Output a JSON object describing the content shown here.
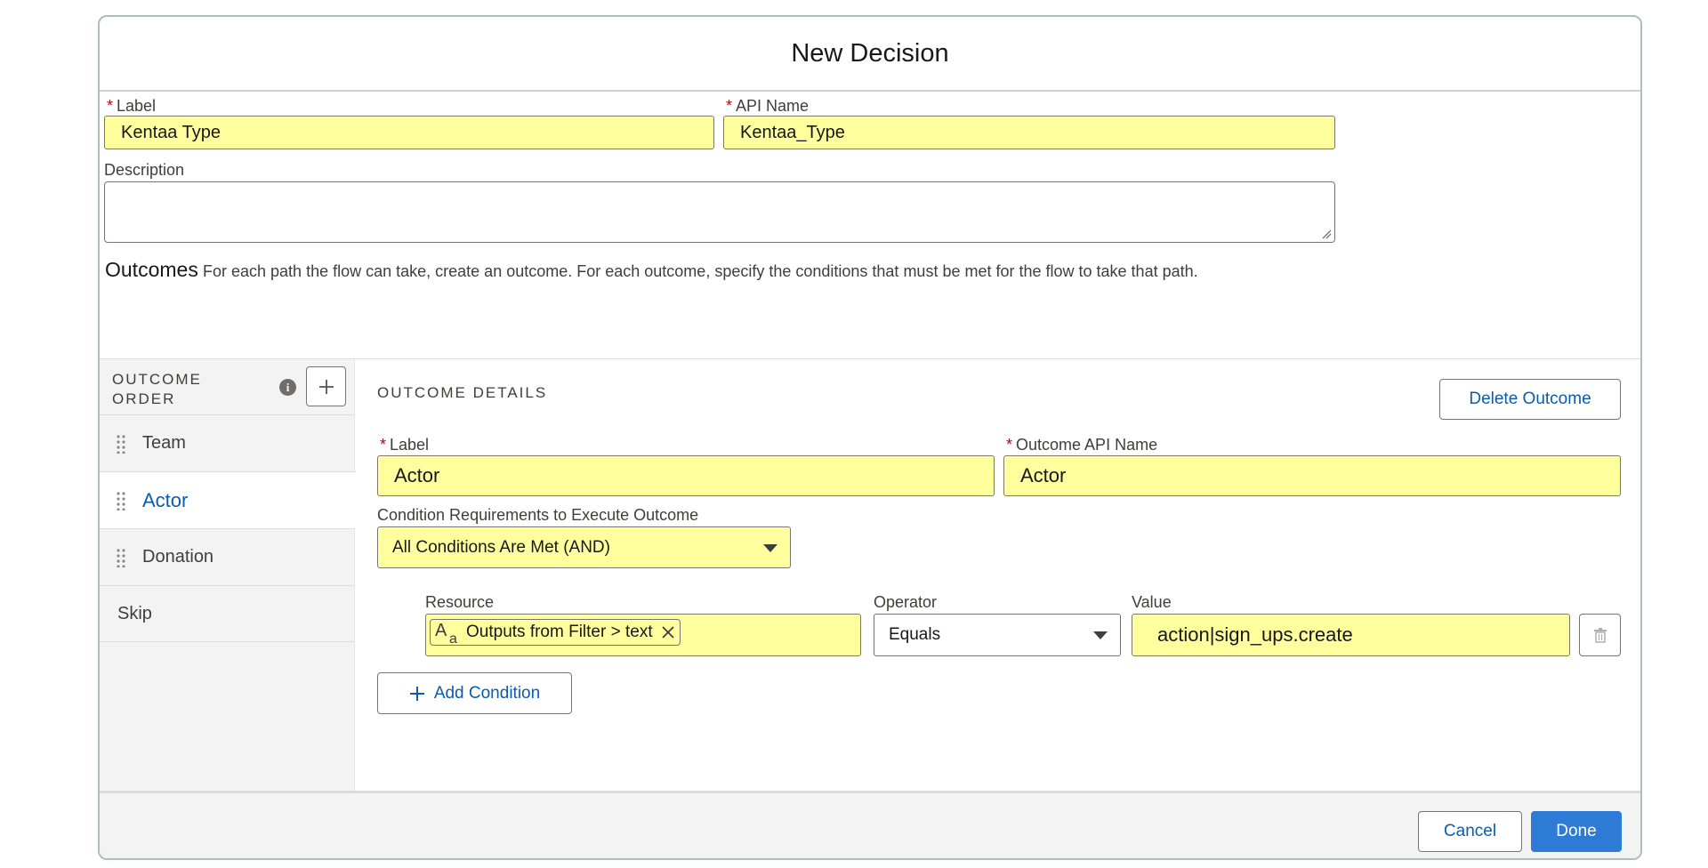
{
  "modal": {
    "title": "New Decision"
  },
  "fields": {
    "label": {
      "label": "Label",
      "value": "Kentaa Type"
    },
    "api_name": {
      "label": "API Name",
      "value": "Kentaa_Type"
    },
    "description": {
      "label": "Description",
      "value": ""
    }
  },
  "outcomes": {
    "title": "Outcomes",
    "description": "For each path the flow can take, create an outcome. For each outcome, specify the conditions that must be met for the flow to take that path.",
    "order_header": "OUTCOME ORDER",
    "items": [
      {
        "label": "Team",
        "draggable": true,
        "active": false
      },
      {
        "label": "Actor",
        "draggable": true,
        "active": true
      },
      {
        "label": "Donation",
        "draggable": true,
        "active": false
      },
      {
        "label": "Skip",
        "draggable": false,
        "active": false
      }
    ]
  },
  "details": {
    "header": "OUTCOME DETAILS",
    "delete_button": "Delete Outcome",
    "label": {
      "label": "Label",
      "value": "Actor"
    },
    "api_name": {
      "label": "Outcome API Name",
      "value": "Actor"
    },
    "condition_requirements": {
      "label": "Condition Requirements to Execute Outcome",
      "value": "All Conditions Are Met (AND)"
    },
    "condition": {
      "resource_label": "Resource",
      "resource_value": "Outputs from Filter > text",
      "operator_label": "Operator",
      "operator_value": "Equals",
      "value_label": "Value",
      "value_value": "action|sign_ups.create"
    },
    "add_condition": "Add Condition"
  },
  "footer": {
    "cancel": "Cancel",
    "done": "Done"
  },
  "colors": {
    "highlight": "#ffff9e",
    "brand": "#0b5cab",
    "done_bg": "#2e7bd6"
  }
}
